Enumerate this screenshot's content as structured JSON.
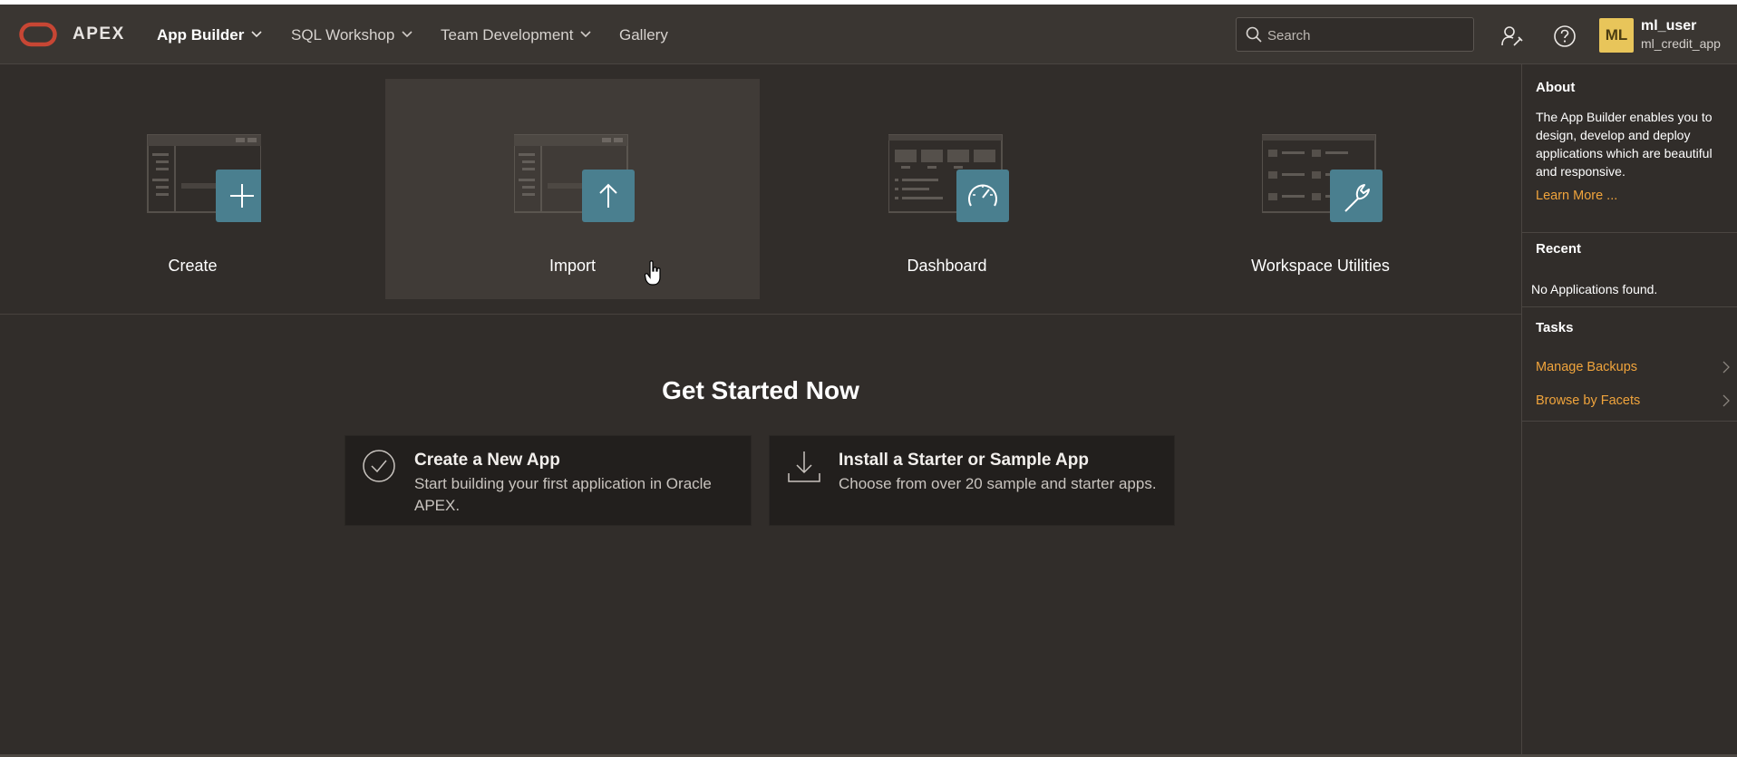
{
  "header": {
    "brand": "APEX",
    "nav": [
      {
        "label": "App Builder",
        "active": true
      },
      {
        "label": "SQL Workshop",
        "active": false
      },
      {
        "label": "Team Development",
        "active": false
      },
      {
        "label": "Gallery",
        "active": false
      }
    ],
    "search_placeholder": "Search",
    "user": {
      "initials": "ML",
      "name": "ml_user",
      "workspace": "ml_credit_app"
    }
  },
  "tiles": [
    {
      "label": "Create",
      "icon": "plus-icon"
    },
    {
      "label": "Import",
      "icon": "arrow-up-icon"
    },
    {
      "label": "Dashboard",
      "icon": "gauge-icon"
    },
    {
      "label": "Workspace Utilities",
      "icon": "wrench-icon"
    }
  ],
  "get_started": {
    "title": "Get Started Now",
    "cards": [
      {
        "title": "Create a New App",
        "desc_line1": "Start building your first application in Oracle",
        "desc_line2": "APEX.",
        "icon": "check-circle-icon"
      },
      {
        "title": "Install a Starter or Sample App",
        "desc_line1": "Choose from over 20 sample and starter apps.",
        "desc_line2": "",
        "icon": "download-icon"
      }
    ]
  },
  "sidebar": {
    "about_heading": "About",
    "about_text": "The App Builder enables you to design, develop and deploy applications which are beautiful and responsive.",
    "learn_more": "Learn More ...",
    "recent_heading": "Recent",
    "recent_empty": "No Applications found.",
    "tasks_heading": "Tasks",
    "tasks": [
      "Manage Backups",
      "Browse by Facets"
    ]
  },
  "colors": {
    "accent_tile": "#4a7f8f",
    "link": "#f0a43c",
    "avatar": "#e8c55a",
    "logo": "#c74634"
  }
}
